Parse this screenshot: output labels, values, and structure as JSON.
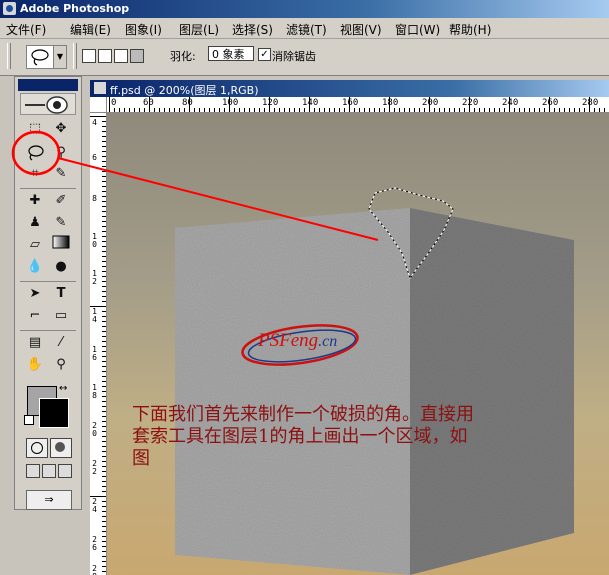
{
  "app": {
    "title": "Adobe Photoshop"
  },
  "menu": [
    "文件(F)",
    "编辑(E)",
    "图象(I)",
    "图层(L)",
    "选择(S)",
    "滤镜(T)",
    "视图(V)",
    "窗口(W)",
    "帮助(H)"
  ],
  "options": {
    "feather_label": "羽化:",
    "feather_value": "0 象素",
    "antialias_checked": "✓",
    "antialias_label": "消除锯齿"
  },
  "document": {
    "title": "ff.psd @ 200%(图层 1,RGB)",
    "hruler": [
      "0",
      "60",
      "80",
      "100",
      "120",
      "140",
      "160",
      "180",
      "200",
      "220",
      "240",
      "260",
      "280"
    ],
    "vruler": [
      "4",
      "6",
      "8",
      "1 0",
      "1 2",
      "1 4",
      "1 6",
      "1 8",
      "2 0",
      "2 2",
      "2 4",
      "2 6",
      "2 8"
    ]
  },
  "tools": {
    "swap_icon": "↔",
    "jump_label": "⇒"
  },
  "watermark": {
    "ps": "PS",
    "feng": "Feng",
    "cn": ".cn"
  },
  "annotation": {
    "line1": "下面我们首先来制作一个破损的角。直接用",
    "line2": "套索工具在图层1的角上画出一个区域，如",
    "line3": "图"
  },
  "colors": {
    "accent": "#cc1111",
    "annotation": "#8c1010",
    "titlebar": "#0a246a"
  }
}
